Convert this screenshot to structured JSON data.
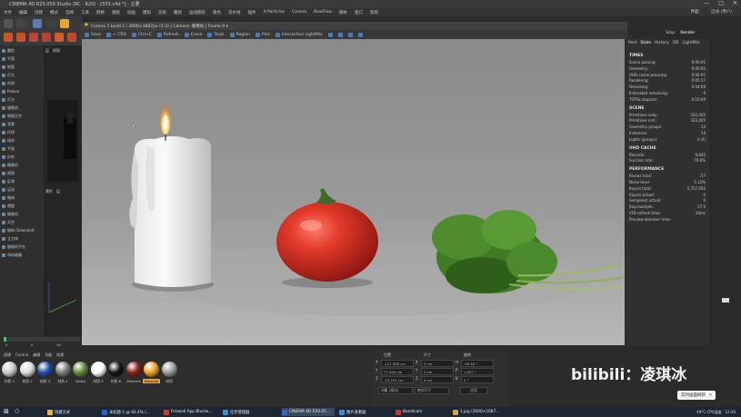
{
  "window": {
    "title": "CINEMA 4D R20.059 Studio (RC - R20) - [555.c4d *] - 主要",
    "controls": [
      "—",
      "□",
      "✕"
    ]
  },
  "menubar": {
    "items": [
      "文件",
      "编辑",
      "创建",
      "模式",
      "选择",
      "工具",
      "网格",
      "捕捉",
      "动画",
      "模拟",
      "渲染",
      "雕刻",
      "运动图形",
      "角色",
      "流水线",
      "插件",
      "X-Particles",
      "Corona",
      "RealFlow",
      "脚本",
      "窗口",
      "帮助"
    ],
    "right": [
      "界面:",
      "启动 (用户)"
    ]
  },
  "render_view": {
    "header": "Corona 5 build 2 | 3000×1687px (1:3) | Camera: 摄像机 | Frame 0 ▾",
    "toolbar": [
      {
        "label": "Save",
        "icon": "save-icon"
      },
      {
        "label": "+ CRD",
        "icon": "crd-icon"
      },
      {
        "label": "Ctrl+C",
        "icon": "copy-icon"
      },
      {
        "label": "Refresh",
        "icon": "refresh-icon"
      },
      {
        "label": "Erase",
        "icon": "erase-icon"
      },
      {
        "label": "Tools",
        "icon": "tools-icon"
      },
      {
        "label": "Region",
        "icon": "region-icon"
      },
      {
        "label": "Pick",
        "icon": "pick-icon"
      },
      {
        "label": "Interactive LightMix",
        "icon": "lightmix-icon"
      }
    ]
  },
  "stats_panel": {
    "tabs": [
      "Post",
      "Stats",
      "History",
      "DR",
      "LightMix"
    ],
    "top_buttons": [
      "Stop",
      "Render"
    ],
    "sections": [
      {
        "title": "TIMES",
        "rows": [
          [
            "Scene parsing:",
            "0:00:01"
          ],
          [
            "Geometry:",
            "0:00:00"
          ],
          [
            "UHD cache precomp:",
            "0:00:01"
          ],
          [
            "Rendering:",
            "0:05:57"
          ],
          [
            "Denoising:",
            "0:04:09"
          ],
          [
            "Estimated remaining:",
            "0"
          ],
          [
            "TOTAL elapsed:",
            "0:10:09"
          ]
        ]
      },
      {
        "title": "SCENE",
        "rows": [
          [
            "Primitives uniq.:",
            "322,405"
          ],
          [
            "Primitives inst.:",
            "322,405"
          ],
          [
            "Geometry groups:",
            "14"
          ],
          [
            "Instances:",
            "14"
          ],
          [
            "Lights (groups):",
            "4 (4)"
          ]
        ]
      },
      {
        "title": "UHD CACHE",
        "rows": [
          [
            "Records:",
            "9,045"
          ],
          [
            "Success rate:",
            "70.0%"
          ]
        ]
      },
      {
        "title": "PERFORMANCE",
        "rows": [
          [
            "Passes total:",
            "7/7"
          ],
          [
            "Noise level:",
            "5.12%"
          ],
          [
            "Rays/s total:",
            "2,757,056"
          ],
          [
            "Rays/s actual:",
            "0"
          ],
          [
            "Samples/s actual:",
            "0"
          ],
          [
            "Rays/sample:",
            "27.6"
          ],
          [
            "VFB refresh time:",
            "26ms"
          ],
          [
            "Preview denoiser time:",
            ""
          ]
        ]
      }
    ]
  },
  "left_panel": {
    "items": [
      "圆柱",
      "平面",
      "地面",
      "灯光",
      "材质",
      "Paloon",
      "灯光",
      "摄像机",
      "物理天空",
      "背景",
      "环境",
      "球体",
      "平面",
      "反射",
      "摄像机",
      "视角",
      "区域",
      "运动",
      "物体",
      "视图",
      "摄像机",
      "天空",
      "物体 (Selected)",
      "立方体",
      "摄像机平台",
      "布料碰撞"
    ]
  },
  "mid_panel": {
    "tabs": [
      "层",
      "视图",
      "显示"
    ],
    "tabs2": [
      "属性",
      "层",
      "显示"
    ]
  },
  "timeline": {
    "frame_start": "0",
    "frame_mid": "0",
    "frame_end": "10",
    "frame_field": "0 F"
  },
  "material_bar": {
    "tabs": [
      "创建",
      "Corona",
      "编辑",
      "功能",
      "纹理"
    ],
    "materials": [
      {
        "name": "材质.1",
        "color": "#c9c9c9"
      },
      {
        "name": "材质.2",
        "color": "#dcdcdc"
      },
      {
        "name": "材质.3",
        "color": "#1f4fa8"
      },
      {
        "name": "材质.4",
        "color": "#7a7a7a"
      },
      {
        "name": "Matte",
        "color": "#5e8a3a"
      },
      {
        "name": "材质.5",
        "color": "#ffffff"
      },
      {
        "name": "材质.6",
        "color": "#111111"
      },
      {
        "name": "Material",
        "color": "#8a1e1e"
      },
      {
        "name": "Material",
        "color": "#f0a020"
      },
      {
        "name": "材质",
        "color": "#9a9a9a"
      }
    ]
  },
  "coord_panel": {
    "headers": [
      "位置",
      "尺寸",
      "旋转"
    ],
    "rows": [
      [
        "X",
        "-127.358 cm",
        "X",
        "0 cm",
        "H",
        "-90.64 °"
      ],
      [
        "Y",
        "77.404 cm",
        "Y",
        "0 cm",
        "P",
        "1.557 °"
      ],
      [
        "Z",
        "-23.707 cm",
        "Z",
        "0 cm",
        "B",
        "0 °"
      ]
    ],
    "dropdowns": [
      "对象 (相对)",
      "绝对尺寸"
    ],
    "apply": "应用"
  },
  "watermark": "bilibili：凌琪冰",
  "notification": "实时画面刷新",
  "taskbar": {
    "items": [
      {
        "label": "快捷方式",
        "color": "#e9b73a"
      },
      {
        "label": "未标题-1 @ 92.4% (...",
        "color": "#2b65c9"
      },
      {
        "label": "Firewall App Blocke...",
        "color": "#c83c3c"
      },
      {
        "label": "任务管理器",
        "color": "#3a8fd0"
      },
      {
        "label": "CINEMA 4D R20.05...",
        "color": "#3467c4"
      },
      {
        "label": "图片查看器",
        "color": "#3c8dd4"
      },
      {
        "label": "Bandicam",
        "color": "#c23a3a"
      },
      {
        "label": "1.jpg (3000×1687...",
        "color": "#d9a23a"
      }
    ],
    "tray_temp": "49°C",
    "tray_temp_label": "CPU温度",
    "clock": "12:20"
  }
}
